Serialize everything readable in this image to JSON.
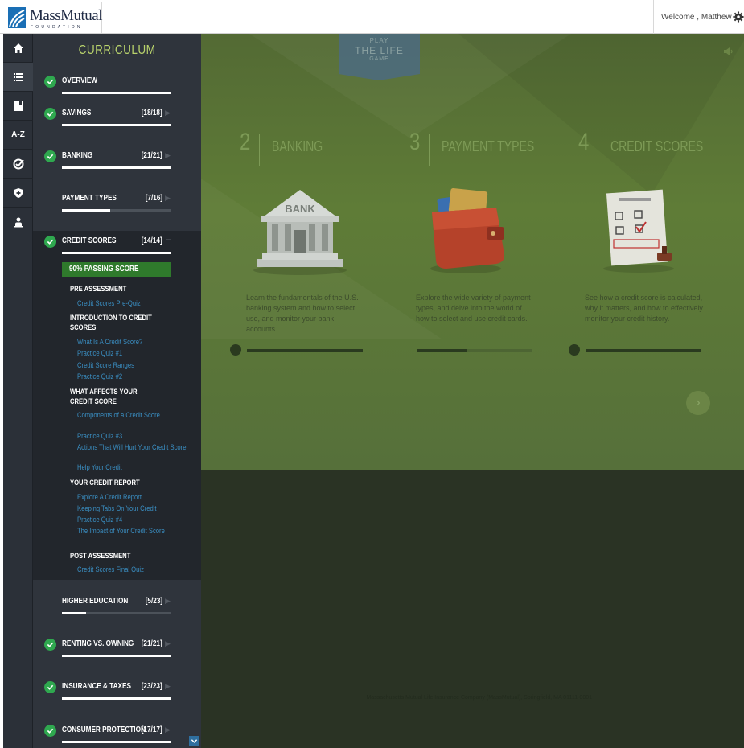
{
  "header": {
    "logo_text": "MassMutual",
    "logo_sub": "FOUNDATION",
    "welcome": "Welcome , Matthew",
    "settings_icon": "gear-icon"
  },
  "rail": {
    "items": [
      {
        "icon": "home-icon"
      },
      {
        "icon": "list-icon"
      },
      {
        "icon": "bookmark-icon"
      },
      {
        "icon": "glossary-icon",
        "label": "A-Z"
      },
      {
        "icon": "check-badge-icon"
      },
      {
        "icon": "shield-icon"
      },
      {
        "icon": "user-icon"
      }
    ]
  },
  "panel": {
    "title": "CURRICULUM",
    "sections": [
      {
        "name": "OVERVIEW",
        "count": "",
        "complete": true,
        "progress": 1.0
      },
      {
        "name": "SAVINGS",
        "count": "[18/18]",
        "complete": true,
        "progress": 1.0
      },
      {
        "name": "BANKING",
        "count": "[21/21]",
        "complete": true,
        "progress": 1.0
      },
      {
        "name": "PAYMENT TYPES",
        "count": "[7/16]",
        "complete": false,
        "progress": 0.44
      },
      {
        "name": "CREDIT SCORES",
        "count": "[14/14]",
        "complete": true,
        "progress": 1.0
      },
      {
        "name": "HIGHER EDUCATION",
        "count": "[5/23]",
        "complete": false,
        "progress": 0.22
      },
      {
        "name": "RENTING VS. OWNING",
        "count": "[21/21]",
        "complete": true,
        "progress": 1.0
      },
      {
        "name": "INSURANCE & TAXES",
        "count": "[23/23]",
        "complete": true,
        "progress": 1.0
      },
      {
        "name": "CONSUMER PROTECTION",
        "count": "[17/17]",
        "complete": true,
        "progress": 1.0
      }
    ],
    "passing_score": "90% PASSING SCORE",
    "subsections": {
      "pre": "PRE ASSESSMENT",
      "pre_links": [
        "Credit Scores Pre-Quiz"
      ],
      "intro": "INTRODUCTION TO CREDIT SCORES",
      "intro_links": [
        "What Is A Credit Score?",
        "Practice Quiz #1",
        "Credit Score Ranges",
        "Practice Quiz #2"
      ],
      "affects": "WHAT AFFECTS YOUR CREDIT SCORE",
      "affects_links": [
        "Components of a Credit Score",
        "Practice Quiz #3",
        "Actions That Will Hurt Your Credit Score",
        "Help Your Credit"
      ],
      "report": "YOUR CREDIT REPORT",
      "report_links": [
        "Explore A Credit Report",
        "Keeping Tabs On Your Credit",
        "Practice Quiz #4",
        "The Impact of Your Credit Score"
      ],
      "post": "POST ASSESSMENT",
      "post_links": [
        "Credit Scores Final Quiz"
      ]
    }
  },
  "main": {
    "play": {
      "l1": "PLAY",
      "l2": "THE LIFE",
      "l3": "GAME"
    },
    "cards": [
      {
        "num": "2",
        "title": "BANKING",
        "desc": "Learn the fundamentals of the U.S. banking system and how to select, use, and monitor your bank accounts.",
        "progress": 1.0,
        "icon": "bank-icon"
      },
      {
        "num": "3",
        "title": "PAYMENT TYPES",
        "desc": "Explore the wide variety of payment types, and delve into the world of how to select and use credit cards.",
        "progress": 0.44,
        "icon": "wallet-icon"
      },
      {
        "num": "4",
        "title": "CREDIT SCORES",
        "desc": "See how a credit score is calculated, why it matters, and how to effectively monitor your credit history.",
        "progress": 1.0,
        "icon": "credit-report-icon"
      }
    ],
    "footer": "Massachusetts Mutual Life Insurance Company (MassMutual), Springfield, MA 01111-0001"
  }
}
